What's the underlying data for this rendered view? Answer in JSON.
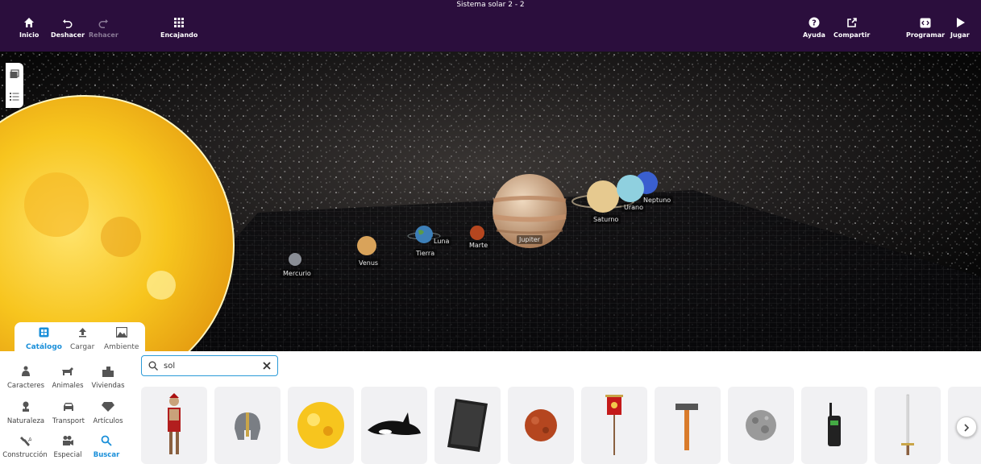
{
  "app": {
    "title": "Sistema solar 2 - 2"
  },
  "toolbar": {
    "inicio": "Inicio",
    "deshacer": "Deshacer",
    "rehacer": "Rehacer",
    "encajando": "Encajando",
    "ayuda": "Ayuda",
    "compartir": "Compartir",
    "programar": "Programar",
    "jugar": "Jugar"
  },
  "scene": {
    "planets": {
      "mercurio": "Mercurio",
      "venus": "Venus",
      "tierra": "Tierra",
      "luna": "Luna",
      "marte": "Marte",
      "jupiter": "Jupiter",
      "saturno": "Saturno",
      "urano": "Urano",
      "neptuno": "Neptuno"
    }
  },
  "catalog_tabs": {
    "catalogo": "Catálogo",
    "cargar": "Cargar",
    "ambiente": "Ambiente"
  },
  "categories": {
    "caracteres": "Caracteres",
    "animales": "Animales",
    "viviendas": "Viviendas",
    "naturaleza": "Naturaleza",
    "transport": "Transport",
    "articulos": "Artículos",
    "construccion": "Construcción",
    "especial": "Especial",
    "buscar": "Buscar"
  },
  "search": {
    "value": "sol"
  },
  "results": [
    {
      "icon": "roman-soldier-icon"
    },
    {
      "icon": "gladiator-helmet-icon"
    },
    {
      "icon": "sun-icon"
    },
    {
      "icon": "orca-icon"
    },
    {
      "icon": "solar-panel-icon"
    },
    {
      "icon": "mars-icon"
    },
    {
      "icon": "roman-banner-icon"
    },
    {
      "icon": "hammer-icon"
    },
    {
      "icon": "moon-icon"
    },
    {
      "icon": "walkie-talkie-icon"
    },
    {
      "icon": "sword-icon"
    }
  ],
  "colors": {
    "topbar": "#2b0e3d",
    "accent": "#1a8fd9",
    "sun": "#f7c51e",
    "jupiter": "#d9b48e"
  }
}
